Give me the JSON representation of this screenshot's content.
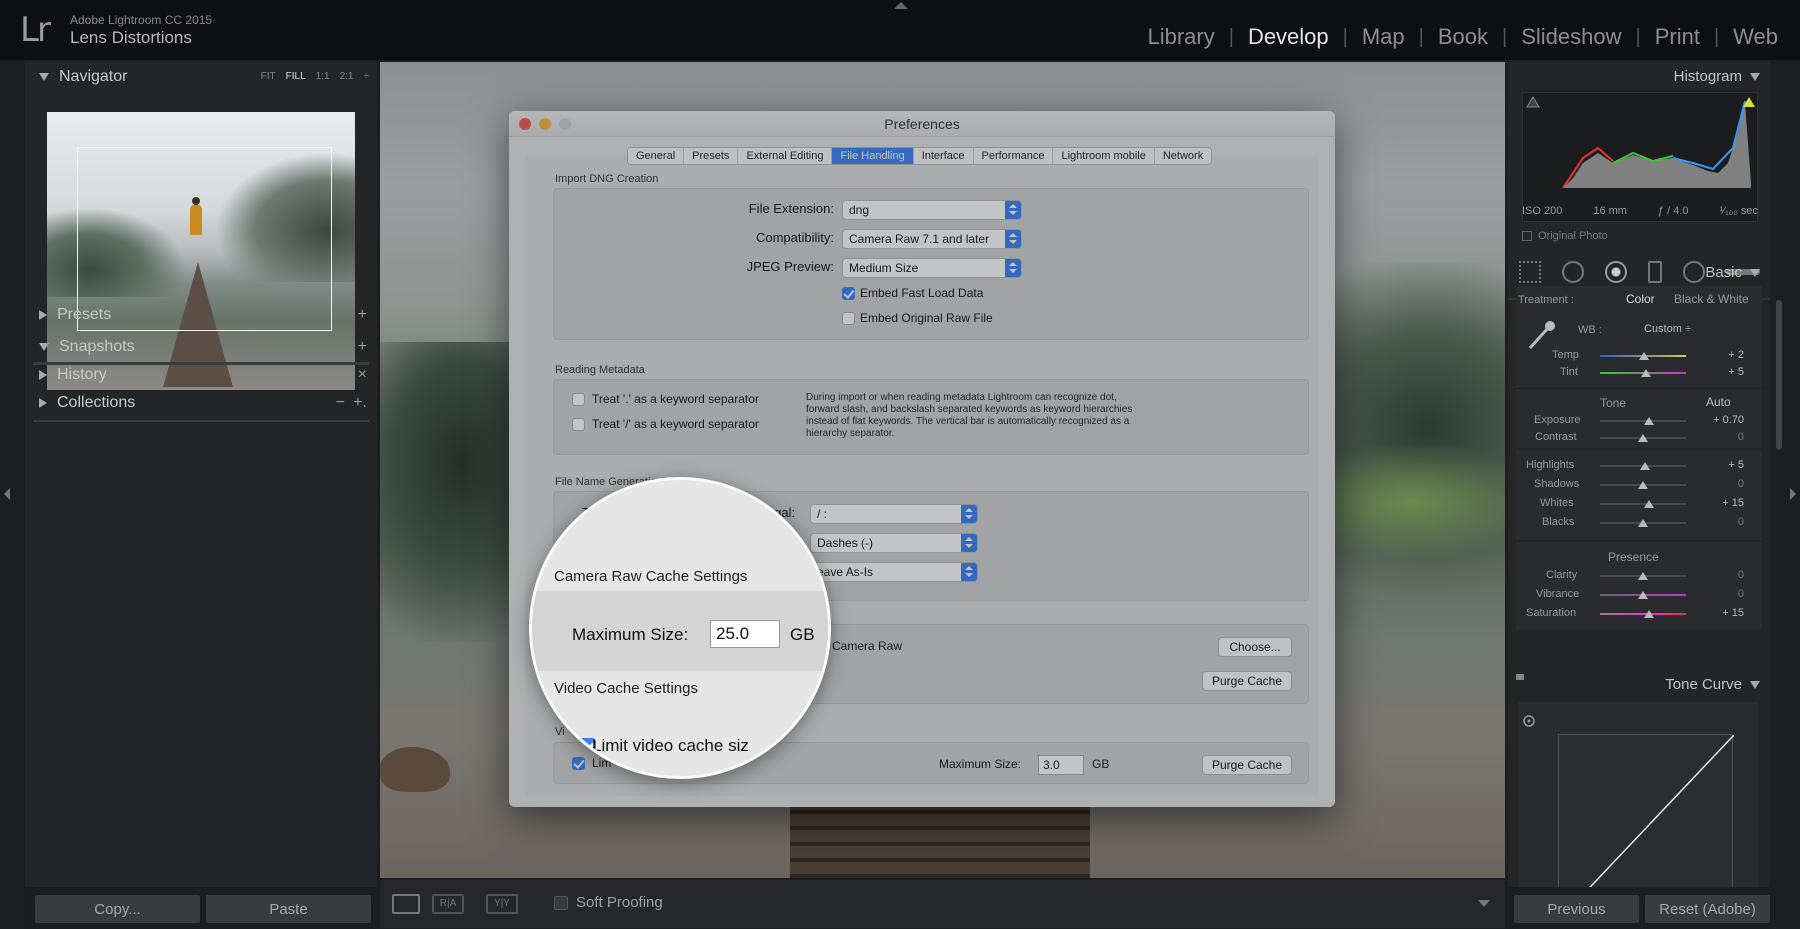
{
  "app": {
    "logo": "Lr",
    "app_name": "Adobe Lightroom CC 2015",
    "catalog_name": "Lens Distortions"
  },
  "modules": [
    "Library",
    "Develop",
    "Map",
    "Book",
    "Slideshow",
    "Print",
    "Web"
  ],
  "active_module": "Develop",
  "left_panel": {
    "navigator": {
      "title": "Navigator",
      "zoom_options": [
        "FIT",
        "FILL",
        "1:1",
        "2:1"
      ],
      "zoom_selected": "FILL",
      "zoom_stepper": "÷"
    },
    "presets": {
      "title": "Presets",
      "action": "+"
    },
    "snapshots": {
      "title": "Snapshots",
      "action": "+"
    },
    "history": {
      "title": "History",
      "action": "×"
    },
    "collections": {
      "title": "Collections",
      "action_minus": "−",
      "action_plus": "+."
    },
    "copy_label": "Copy...",
    "paste_label": "Paste"
  },
  "toolbar": {
    "compare_label": "R|A",
    "survey_label": "Y|Y",
    "soft_proofing_label": "Soft Proofing"
  },
  "right_panel": {
    "histogram": {
      "title": "Histogram",
      "iso": "ISO 200",
      "focal": "16 mm",
      "aperture": "ƒ / 4.0",
      "shutter": "¹⁄₁₀₀ sec",
      "original_photo_label": "Original Photo"
    },
    "basic": {
      "title": "Basic",
      "treatment_label": "Treatment :",
      "treatment_color": "Color",
      "treatment_bw": "Black & White",
      "wb_label": "WB :",
      "wb_value": "Custom ÷",
      "temp_label": "Temp",
      "temp_value": "+ 2",
      "tint_label": "Tint",
      "tint_value": "+ 5",
      "tone_label": "Tone",
      "auto_label": "Auto",
      "exposure_label": "Exposure",
      "exposure_value": "+ 0.70",
      "contrast_label": "Contrast",
      "contrast_value": "0",
      "highlights_label": "Highlights",
      "highlights_value": "+ 5",
      "shadows_label": "Shadows",
      "shadows_value": "0",
      "whites_label": "Whites",
      "whites_value": "+ 15",
      "blacks_label": "Blacks",
      "blacks_value": "0",
      "presence_label": "Presence",
      "clarity_label": "Clarity",
      "clarity_value": "0",
      "vibrance_label": "Vibrance",
      "vibrance_value": "0",
      "saturation_label": "Saturation",
      "saturation_value": "+ 15"
    },
    "tone_curve": {
      "title": "Tone Curve"
    },
    "previous_label": "Previous",
    "reset_label": "Reset (Adobe)"
  },
  "dialog": {
    "title": "Preferences",
    "tabs": [
      "General",
      "Presets",
      "External Editing",
      "File Handling",
      "Interface",
      "Performance",
      "Lightroom mobile",
      "Network"
    ],
    "active_tab": "File Handling",
    "import_dng": {
      "label": "Import DNG Creation",
      "file_extension_label": "File Extension:",
      "file_extension_value": "dng",
      "compatibility_label": "Compatibility:",
      "compatibility_value": "Camera Raw 7.1 and later",
      "jpeg_preview_label": "JPEG Preview:",
      "jpeg_preview_value": "Medium Size",
      "embed_fast_load": "Embed Fast Load Data",
      "embed_original_raw": "Embed Original Raw File"
    },
    "reading_metadata": {
      "label": "Reading Metadata",
      "treat_dot": "Treat '.' as a keyword separator",
      "treat_slash": "Treat '/' as a keyword separator",
      "help": "During import or when reading metadata Lightroom can recognize dot, forward slash, and backslash separated keywords as keyword hierarchies instead of flat keywords. The vertical bar is automatically recognized as a hierarchy separator."
    },
    "file_name_generation": {
      "label": "File Name Generation",
      "row1_label_partial": "Tr",
      "row1_label_end": "legal:",
      "illegal_value": "/ :",
      "spaces_value": "Dashes (-)",
      "case_value": "eave As-Is"
    },
    "camera_raw_cache": {
      "location_partial": "Camera Raw",
      "choose_label": "Choose...",
      "purge_label": "Purge Cache"
    },
    "video_cache": {
      "label_partial": "Vi",
      "limit_partial": "Lim",
      "max_size_label": "Maximum Size:",
      "max_size_value": "3.0",
      "unit": "GB",
      "purge_label": "Purge Cache"
    }
  },
  "magnifier": {
    "camera_raw_label": "Camera Raw Cache Settings",
    "max_size_label": "Maximum Size:",
    "max_size_value": "25.0",
    "unit": "GB",
    "video_label": "Video Cache Settings",
    "limit_video_label": "Limit video cache siz"
  }
}
